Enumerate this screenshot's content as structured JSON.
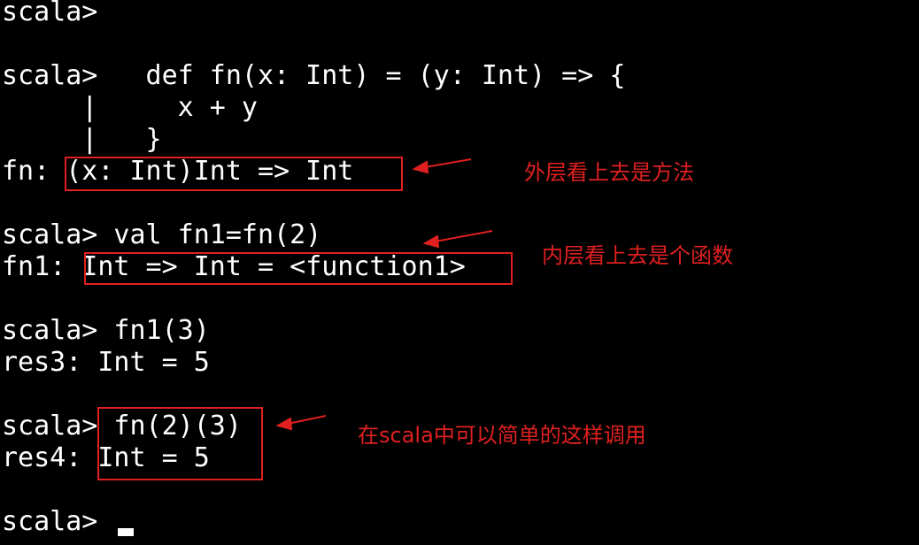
{
  "terminal": {
    "lines": [
      "scala>",
      "",
      "scala>   def fn(x: Int) = (y: Int) => {",
      "     |     x + y",
      "     |   }",
      "fn: (x: Int)Int => Int",
      "",
      "scala> val fn1=fn(2)",
      "fn1: Int => Int = <function1>",
      "",
      "scala> fn1(3)",
      "res3: Int = 5",
      "",
      "scala> fn(2)(3)",
      "res4: Int = 5",
      "",
      "scala> "
    ]
  },
  "annotations": {
    "note1": "外层看上去是方法",
    "note2": "内层看上去是个函数",
    "note3": "在scala中可以简单的这样调用",
    "color": "#e02020"
  },
  "colors": {
    "background": "#000000",
    "text": "#ffffff",
    "annotation": "#e02020"
  }
}
